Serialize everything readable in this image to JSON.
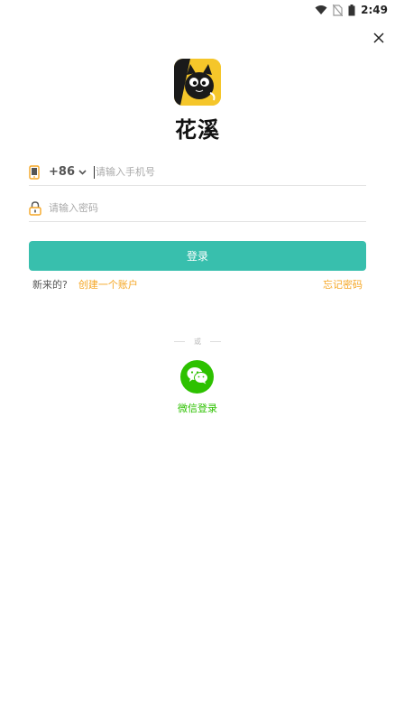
{
  "status_bar": {
    "time": "2:49",
    "icons": [
      "wifi-icon",
      "no-sim-icon",
      "battery-icon"
    ]
  },
  "header": {
    "close_icon": "close-icon"
  },
  "app": {
    "name": "花溪"
  },
  "login_form": {
    "country_code": "+86",
    "phone_placeholder": "请输入手机号",
    "password_placeholder": "请输入密码",
    "login_button": "登录"
  },
  "links": {
    "new_user": "新来的?",
    "create_account": "创建一个账户",
    "forgot_password": "忘记密码"
  },
  "alternate_login": {
    "or_text": "或",
    "wechat_label": "微信登录"
  },
  "colors": {
    "accent": "#38bfad",
    "link": "#f5a623",
    "wechat": "#2dc100",
    "logo_bg": "#f5c62a"
  }
}
